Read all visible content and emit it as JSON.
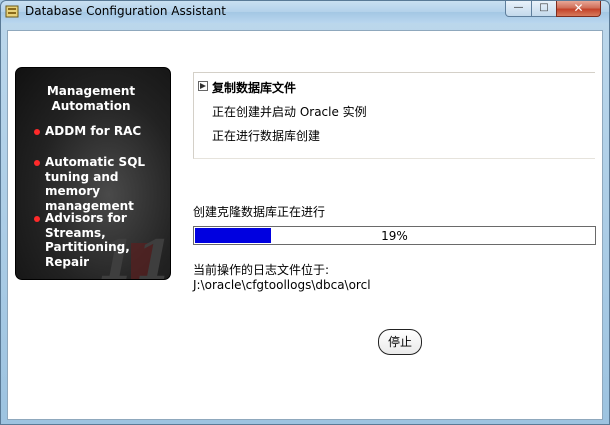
{
  "window": {
    "title": "Database Configuration Assistant",
    "controls": {
      "minimize": "—",
      "maximize": "□",
      "close": "✕"
    }
  },
  "promo": {
    "heading": "Management Automation",
    "items": [
      "ADDM for RAC",
      "Automatic SQL tuning and memory management",
      "Advisors for Streams, Partitioning, Repair"
    ],
    "watermark": "11g"
  },
  "steps": [
    {
      "label": "复制数据库文件",
      "status": "current"
    },
    {
      "label": "正在创建并启动 Oracle 实例",
      "status": "pending"
    },
    {
      "label": "正在进行数据库创建",
      "status": "pending"
    }
  ],
  "progress": {
    "label": "创建克隆数据库正在进行",
    "percent": 19,
    "text": "19%"
  },
  "log": {
    "label": "当前操作的日志文件位于:",
    "path": "J:\\oracle\\cfgtoollogs\\dbca\\orcl"
  },
  "buttons": {
    "stop": "停止"
  },
  "colors": {
    "progress_fill": "#0000e0",
    "bullet": "#ff2a2a",
    "close_button": "#c4432a"
  }
}
